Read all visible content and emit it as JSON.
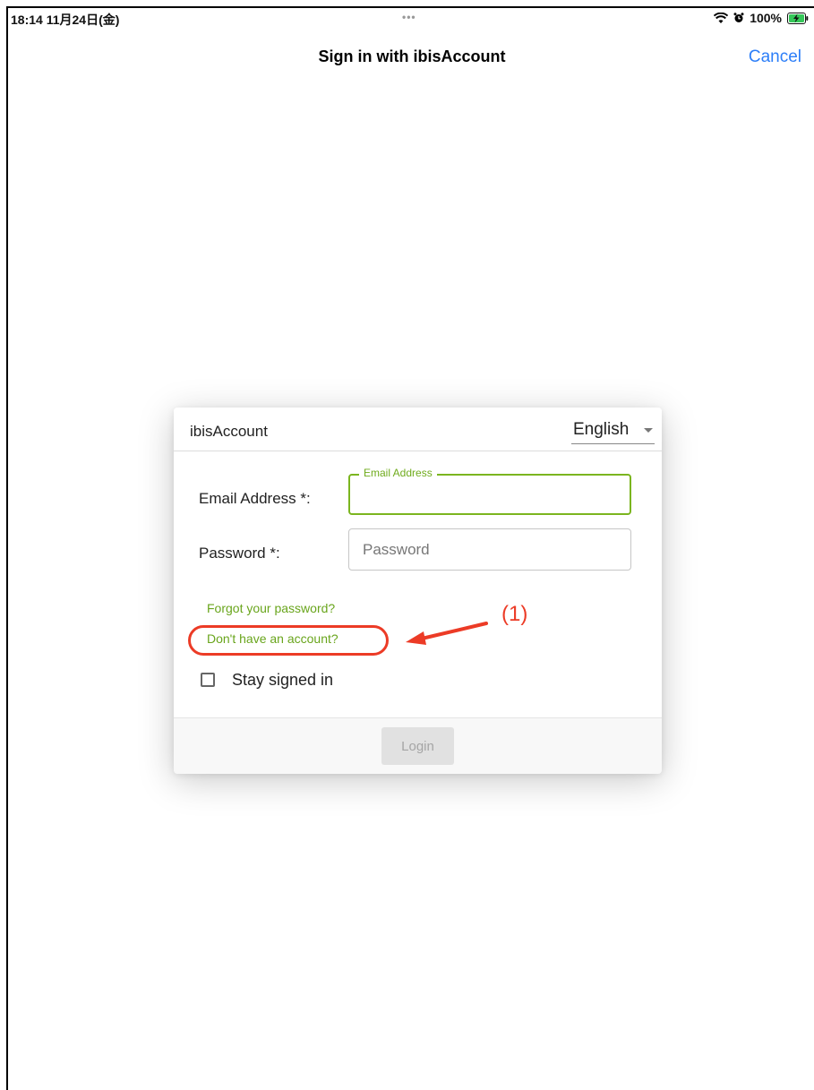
{
  "status_bar": {
    "time_date": "18:14 11月24日(金)",
    "dots": "•••",
    "battery_percent": "100%"
  },
  "navigation": {
    "title": "Sign in with ibisAccount",
    "cancel_label": "Cancel"
  },
  "dialog": {
    "title": "ibisAccount",
    "language": "English",
    "email": {
      "label": "Email Address *:",
      "floating_label": "Email Address",
      "value": ""
    },
    "password": {
      "label": "Password *:",
      "placeholder": "Password",
      "value": ""
    },
    "forgot_password": "Forgot your password?",
    "no_account": "Don't have an account?",
    "stay_signed_in": "Stay signed in",
    "stay_signed_in_checked": false,
    "login_button": "Login"
  },
  "annotation": {
    "label": "(1)",
    "color": "#ec3b26"
  },
  "colors": {
    "accent_green": "#7bb51f",
    "link_blue": "#2c7ef8",
    "annotation_red": "#ec3b26"
  }
}
